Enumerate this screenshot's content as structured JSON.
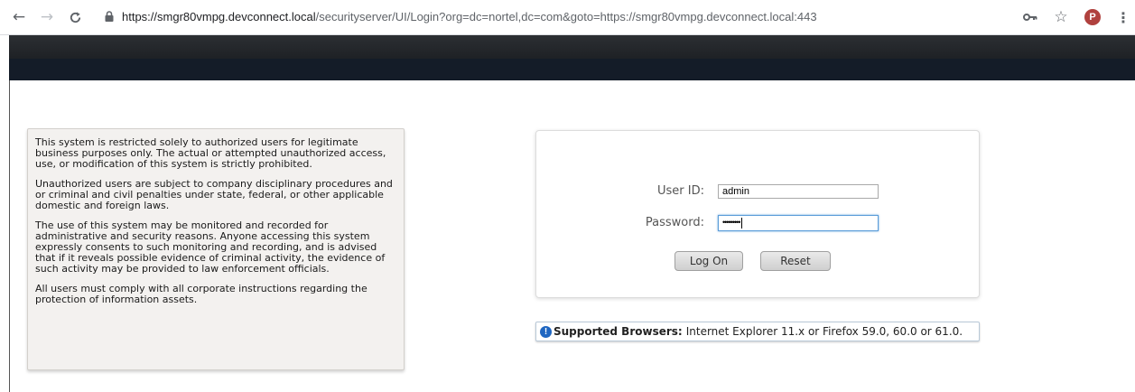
{
  "browser": {
    "url_host": "https://smgr80vmpg.devconnect.local",
    "url_path": "/securityserver/UI/Login?org=dc=nortel,dc=com&goto=https://smgr80vmpg.devconnect.local:443",
    "avatar_letter": "P",
    "icons": [
      "back-icon",
      "forward-icon",
      "reload-icon",
      "lock-icon",
      "key-icon",
      "star-icon",
      "menu-icon"
    ]
  },
  "warning": {
    "paragraphs": [
      "This system is restricted solely to authorized users for legitimate business purposes only. The actual or attempted unauthorized access, use, or modification of this system is strictly prohibited.",
      "Unauthorized users are subject to company disciplinary procedures and or criminal and civil penalties under state, federal, or other applicable domestic and foreign laws.",
      "The use of this system may be monitored and recorded for administrative and security reasons. Anyone accessing this system expressly consents to such monitoring and recording, and is advised that if it reveals possible evidence of criminal activity, the evidence of such activity may be provided to law enforcement officials.",
      "All users must comply with all corporate instructions regarding the protection of information assets."
    ]
  },
  "login": {
    "user_id_label": "User ID:",
    "user_id_value": "admin",
    "password_label": "Password:",
    "password_value": "•••••••••",
    "logon_label": "Log On",
    "reset_label": "Reset"
  },
  "support": {
    "icon": "!",
    "heading": "Supported Browsers:",
    "text": "Internet Explorer 11.x or Firefox 59.0, 60.0 or 61.0."
  },
  "colors": {
    "banner_dark": "#141c28",
    "info_blue": "#1f66c1",
    "focus_blue": "#5b9dd9",
    "avatar": "#b0413e"
  }
}
